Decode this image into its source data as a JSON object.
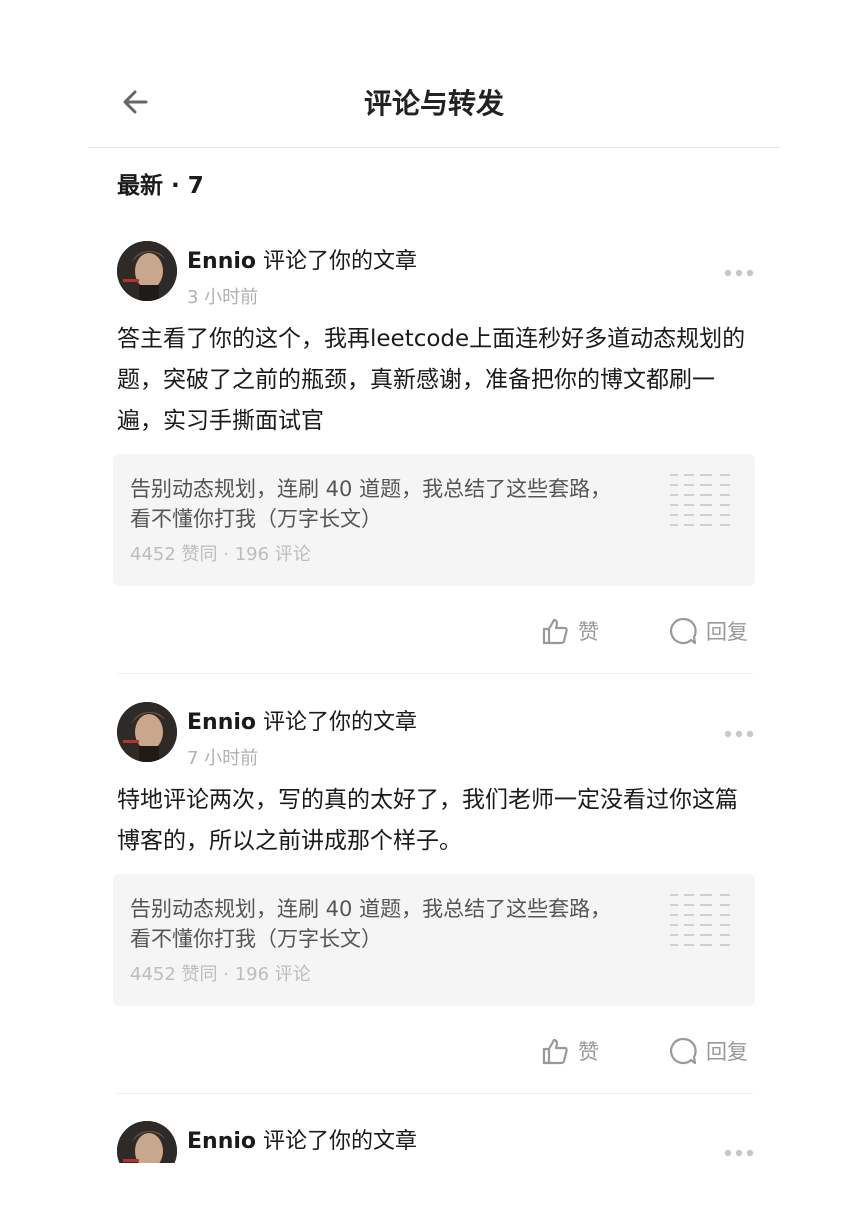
{
  "header": {
    "title": "评论与转发"
  },
  "section": {
    "label": "最新 · 7"
  },
  "items": [
    {
      "author": "Ennio",
      "action": " 评论了你的文章",
      "time": "3 小时前",
      "comment": "答主看了你的这个，我再leetcode上面连秒好多道动态规划的题，突破了之前的瓶颈，真新感谢，准备把你的博文都刷一遍，实习手撕面试官",
      "article": {
        "title": "告别动态规划，连刷 40 道题，我总结了这些套路，看不懂你打我（万字长文）",
        "stats": "4452 赞同 · 196 评论"
      },
      "like_label": "赞",
      "reply_label": "回复"
    },
    {
      "author": "Ennio",
      "action": " 评论了你的文章",
      "time": "7 小时前",
      "comment": "特地评论两次，写的真的太好了，我们老师一定没看过你这篇博客的，所以之前讲成那个样子。",
      "article": {
        "title": "告别动态规划，连刷 40 道题，我总结了这些套路，看不懂你打我（万字长文）",
        "stats": "4452 赞同 · 196 评论"
      },
      "like_label": "赞",
      "reply_label": "回复"
    },
    {
      "author": "Ennio",
      "action": " 评论了你的文章"
    }
  ],
  "icons": {
    "back": "arrow-left-icon",
    "more": "more-dots-icon",
    "like": "thumbs-up-icon",
    "reply": "comment-bubble-icon"
  },
  "colors": {
    "text": "#1a1a1a",
    "muted": "#999999",
    "card_bg": "#f5f5f5",
    "divider": "#eeeeee"
  }
}
